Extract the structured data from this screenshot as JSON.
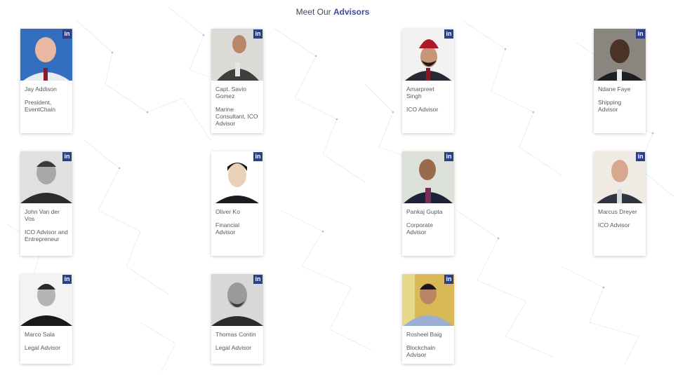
{
  "header": {
    "prefix": "Meet Our",
    "accent": "Advisors"
  },
  "colors": {
    "accent": "#3b4a9c",
    "linkedin": "#2d3e8c",
    "text": "#555a61"
  },
  "advisors": [
    {
      "name": "Jay Addison",
      "role": "President, EventChain",
      "linkedin_label": "in",
      "icon": "linkedin-icon"
    },
    {
      "name": "Capt. Savio Gomez",
      "role": "Marine Consultant, ICO Advisor",
      "linkedin_label": "in",
      "icon": "linkedin-icon"
    },
    {
      "name": "Amarpreet Singh",
      "role": "ICO Advisor",
      "linkedin_label": "in",
      "icon": "linkedin-icon"
    },
    {
      "name": "Ndane Faye",
      "role": "Shipping Advisor",
      "linkedin_label": "in",
      "icon": "linkedin-icon"
    },
    {
      "name": "John Van der Vos",
      "role": "ICO Advisor and Entrepreneur",
      "linkedin_label": "in",
      "icon": "linkedin-icon"
    },
    {
      "name": "Oliver Ko",
      "role": "Financial Advisor",
      "linkedin_label": "in",
      "icon": "linkedin-icon"
    },
    {
      "name": "Pankaj Gupta",
      "role": "Corporate Advisor",
      "linkedin_label": "in",
      "icon": "linkedin-icon"
    },
    {
      "name": "Marcus Dreyer",
      "role": "ICO Advisor",
      "linkedin_label": "in",
      "icon": "linkedin-icon"
    },
    {
      "name": "Marco Sala",
      "role": "Legal Advisor",
      "linkedin_label": "in",
      "icon": "linkedin-icon"
    },
    {
      "name": "Thomas Contin",
      "role": "Legal Advisor",
      "linkedin_label": "in",
      "icon": "linkedin-icon"
    },
    {
      "name": "Rosheel Baig",
      "role": "Blockchain Advisor",
      "linkedin_label": "in",
      "icon": "linkedin-icon"
    }
  ]
}
